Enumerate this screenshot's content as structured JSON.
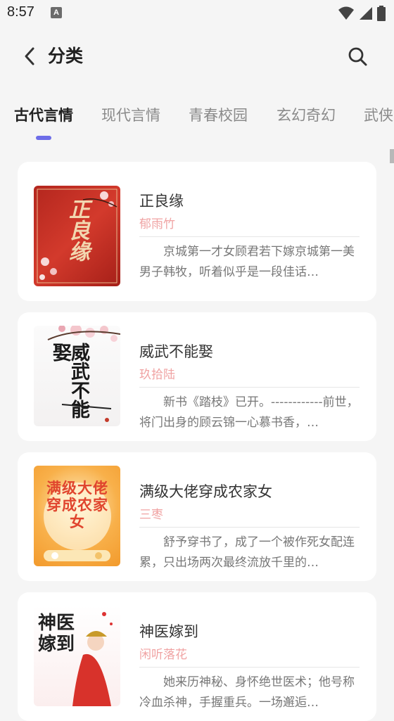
{
  "status_bar": {
    "time": "8:57",
    "app_icon_letter": "A",
    "icons": [
      "wifi-icon",
      "signal-icon",
      "battery-icon"
    ]
  },
  "header": {
    "back_icon": "chevron-left-icon",
    "title": "分类",
    "search_icon": "search-icon"
  },
  "tabs": [
    {
      "label": "古代言情",
      "active": true
    },
    {
      "label": "现代言情",
      "active": false
    },
    {
      "label": "青春校园",
      "active": false
    },
    {
      "label": "玄幻奇幻",
      "active": false
    },
    {
      "label": "武侠",
      "active": false
    }
  ],
  "colors": {
    "accent": "#6d6de8",
    "author": "#f0a3a3",
    "card_bg": "#ffffff",
    "page_bg": "#f5f5f5"
  },
  "books": [
    {
      "title": "正良缘",
      "author": "郁雨竹",
      "description": "京城第一才女顾君若下嫁京城第一美男子韩牧，听着似乎是一段佳话…",
      "cover_text": "正良缘"
    },
    {
      "title": "威武不能娶",
      "author": "玖拾陆",
      "description": "新书《踏枝》已开。------------前世，将门出身的顾云锦一心慕书香，…",
      "cover_text": "威武不能娶"
    },
    {
      "title": "满级大佬穿成农家女",
      "author": "三枣",
      "description": "舒予穿书了，成了一个被作死女配连累，只出场两次最终流放千里的…",
      "cover_text": "满级大佬穿成农家女"
    },
    {
      "title": "神医嫁到",
      "author": "闲听落花",
      "description": "她来历神秘、身怀绝世医术；他号称冷血杀神，手握重兵。一场邂逅…",
      "cover_text": "神医嫁到"
    }
  ]
}
